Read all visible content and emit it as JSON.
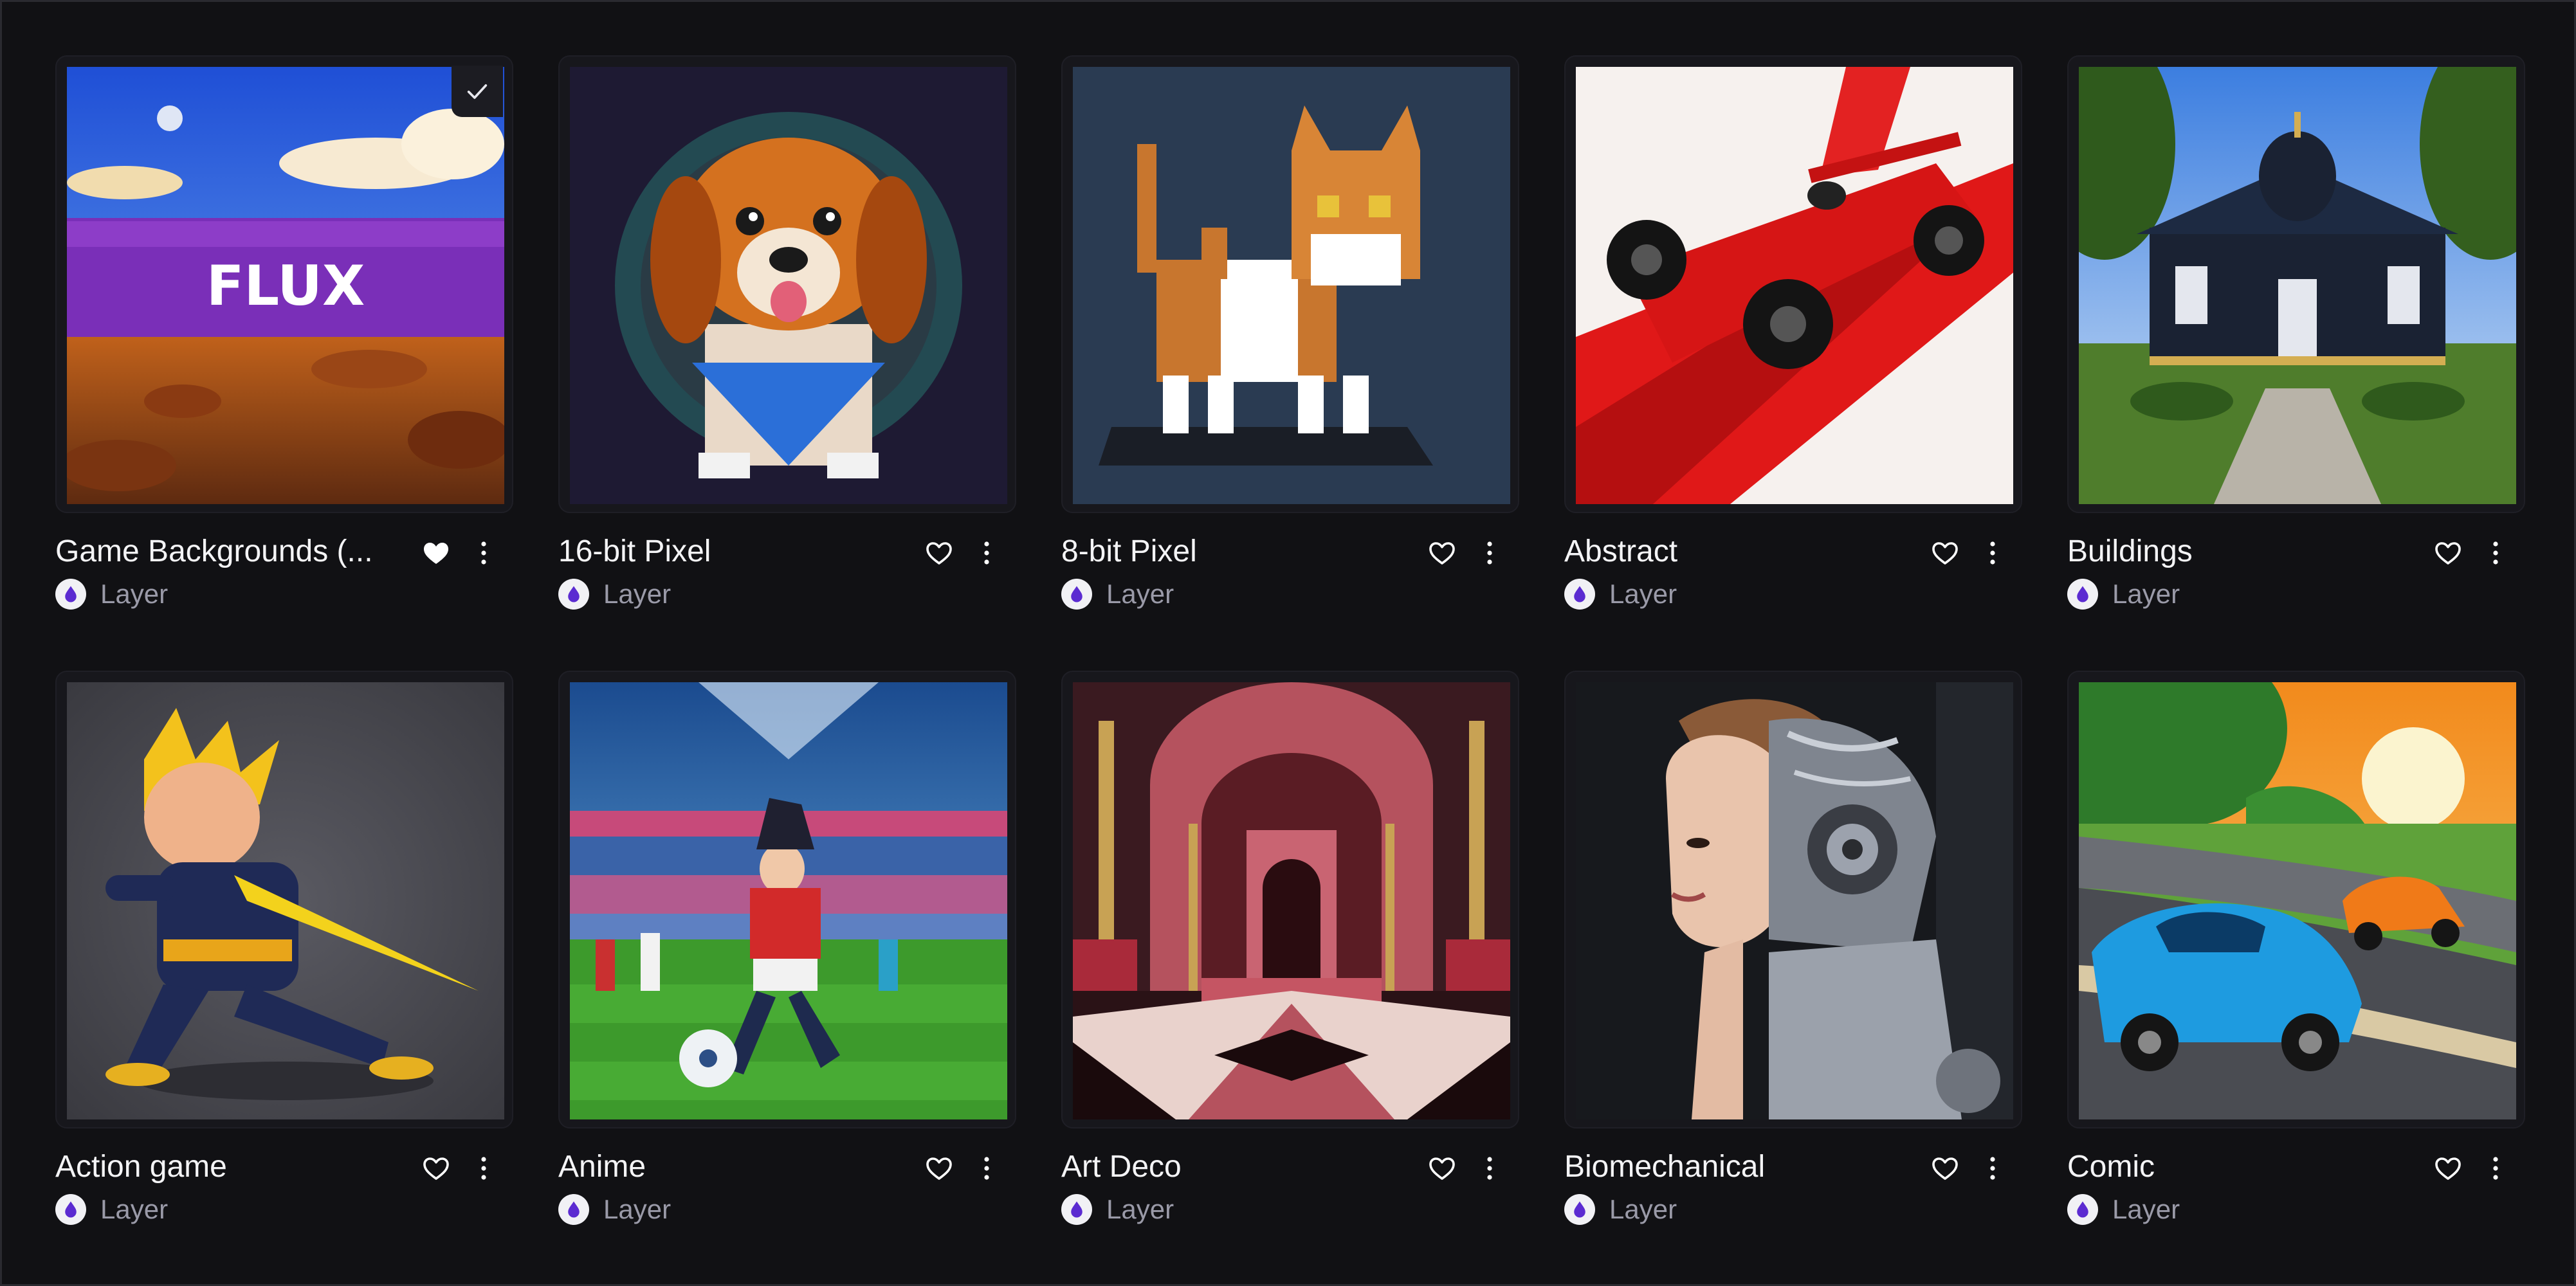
{
  "colors": {
    "background": "#111114",
    "card": "#17171c",
    "title": "#f4f4f6",
    "owner": "#9a9aa8",
    "accent": "#6f3bd8"
  },
  "cards": [
    {
      "title": "Game Backgrounds (...",
      "owner": "Layer",
      "favorited": true,
      "selected": true,
      "image": "flux-desert-landscape",
      "image_text": "FLUX"
    },
    {
      "title": "16-bit Pixel",
      "owner": "Layer",
      "favorited": false,
      "selected": false,
      "image": "pixel-dog"
    },
    {
      "title": "8-bit Pixel",
      "owner": "Layer",
      "favorited": false,
      "selected": false,
      "image": "pixel-cat"
    },
    {
      "title": "Abstract",
      "owner": "Layer",
      "favorited": false,
      "selected": false,
      "image": "red-race-car"
    },
    {
      "title": "Buildings",
      "owner": "Layer",
      "favorited": false,
      "selected": false,
      "image": "ornate-mansion"
    },
    {
      "title": "Action game",
      "owner": "Layer",
      "favorited": false,
      "selected": false,
      "image": "spiky-hair-fighter"
    },
    {
      "title": "Anime",
      "owner": "Layer",
      "favorited": false,
      "selected": false,
      "image": "anime-soccer"
    },
    {
      "title": "Art Deco",
      "owner": "Layer",
      "favorited": false,
      "selected": false,
      "image": "art-deco-hall"
    },
    {
      "title": "Biomechanical",
      "owner": "Layer",
      "favorited": false,
      "selected": false,
      "image": "cyborg-woman"
    },
    {
      "title": "Comic",
      "owner": "Layer",
      "favorited": false,
      "selected": false,
      "image": "comic-sports-cars"
    }
  ]
}
